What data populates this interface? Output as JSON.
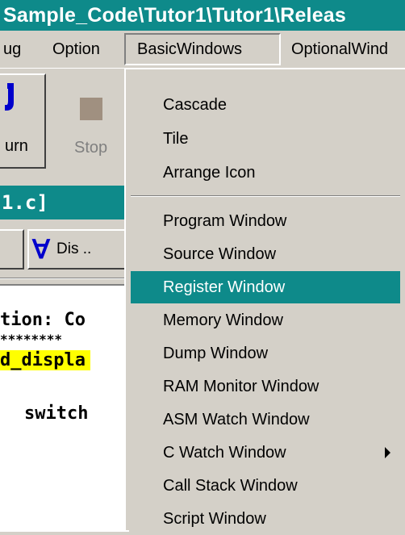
{
  "title_bar": {
    "text": "Sample_Code\\Tutor1\\Tutor1\\Releas",
    "color": "#0e8a8a"
  },
  "menu_bar": {
    "items": [
      {
        "label": "ug"
      },
      {
        "label": "Option"
      },
      {
        "label": "BasicWindows"
      },
      {
        "label": "OptionalWind"
      }
    ]
  },
  "toolbar": {
    "return_label": "urn",
    "stop_label": "Stop"
  },
  "source_window": {
    "title": "1.c]",
    "dis_button_label": "Dis ..",
    "code_lines": [
      "tion: Co",
      "********",
      "d_displa",
      "switch"
    ]
  },
  "dropdown": {
    "items": [
      {
        "label": "Cascade"
      },
      {
        "label": "Tile"
      },
      {
        "label": "Arrange Icon"
      },
      {
        "label": "Program Window"
      },
      {
        "label": "Source Window"
      },
      {
        "label": "Register Window",
        "highlighted": true
      },
      {
        "label": "Memory Window"
      },
      {
        "label": "Dump Window"
      },
      {
        "label": "RAM Monitor Window"
      },
      {
        "label": "ASM Watch Window"
      },
      {
        "label": "C Watch Window",
        "has_submenu": true
      },
      {
        "label": "Call Stack Window"
      },
      {
        "label": "Script Window"
      }
    ]
  }
}
